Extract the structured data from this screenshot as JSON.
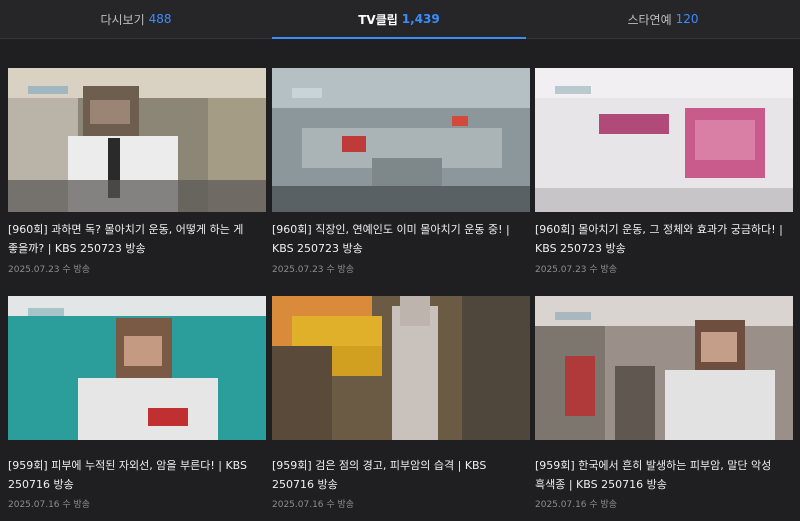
{
  "tabs": [
    {
      "label": "다시보기",
      "count": "488"
    },
    {
      "label": "TV클립",
      "count": "1,439"
    },
    {
      "label": "스타연예",
      "count": "120"
    }
  ],
  "active_tab": 1,
  "accent_color": "#3b8cff",
  "videos": [
    {
      "title": "[960회] 과하면 독? 몰아치기 운동, 어떻게 하는 게 좋을까? | KBS 250723 방송",
      "date": "2025.07.23 수 방송"
    },
    {
      "title": "[960회] 직장인, 연예인도 이미 몰아치기 운동 중! | KBS 250723 방송",
      "date": "2025.07.23 수 방송"
    },
    {
      "title": "[960회] 몰아치기 운동, 그 정체와 효과가 궁금하다! | KBS 250723 방송",
      "date": "2025.07.23 수 방송"
    },
    {
      "title": "[959회] 피부에 누적된 자외선, 암을 부른다! | KBS 250716 방송",
      "date": "2025.07.16 수 방송"
    },
    {
      "title": "[959회] 검은 점의 경고, 피부암의 습격 | KBS 250716 방송",
      "date": "2025.07.16 수 방송"
    },
    {
      "title": "[959회] 한국에서 흔히 발생하는 피부암, 말단 악성 흑색종 | KBS 250716 방송",
      "date": "2025.07.16 수 방송"
    }
  ]
}
